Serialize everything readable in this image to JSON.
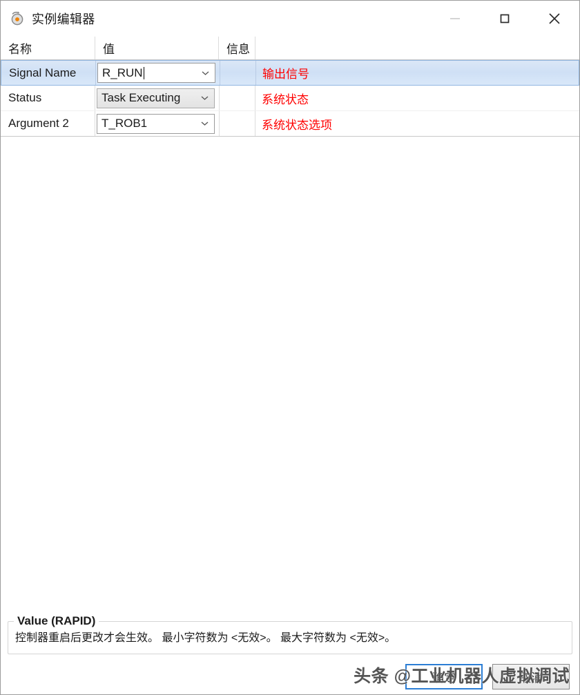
{
  "window": {
    "title": "实例编辑器",
    "icon": "instance-editor-icon",
    "minimize_label": "—",
    "maximize_label": "□",
    "close_label": "✕"
  },
  "grid": {
    "columns": [
      "名称",
      "值",
      "信息",
      ""
    ],
    "rows": [
      {
        "name": "Signal Name",
        "value": "R_RUN",
        "info": "输出信号",
        "selected": true,
        "disabled": false,
        "editing": true
      },
      {
        "name": "Status",
        "value": "Task Executing",
        "info": "系统状态",
        "selected": false,
        "disabled": true,
        "editing": false
      },
      {
        "name": "Argument 2",
        "value": "T_ROB1",
        "info": "系统状态选项",
        "selected": false,
        "disabled": false,
        "editing": false
      }
    ]
  },
  "value_group": {
    "title": "Value (RAPID)",
    "description": "控制器重启后更改才会生效。 最小字符数为 <无效>。 最大字符数为 <无效>。"
  },
  "footer": {
    "ok_label": "确定",
    "cancel_label": "取消"
  },
  "watermark": {
    "text": "头条 @工业机器人虚拟调试"
  },
  "colors": {
    "info_text": "#ff0000",
    "selection_bg": "#cfe0f5",
    "selection_border": "#8fb5e0",
    "focus_border": "#2b7dd4",
    "icon_accent": "#f08200"
  }
}
